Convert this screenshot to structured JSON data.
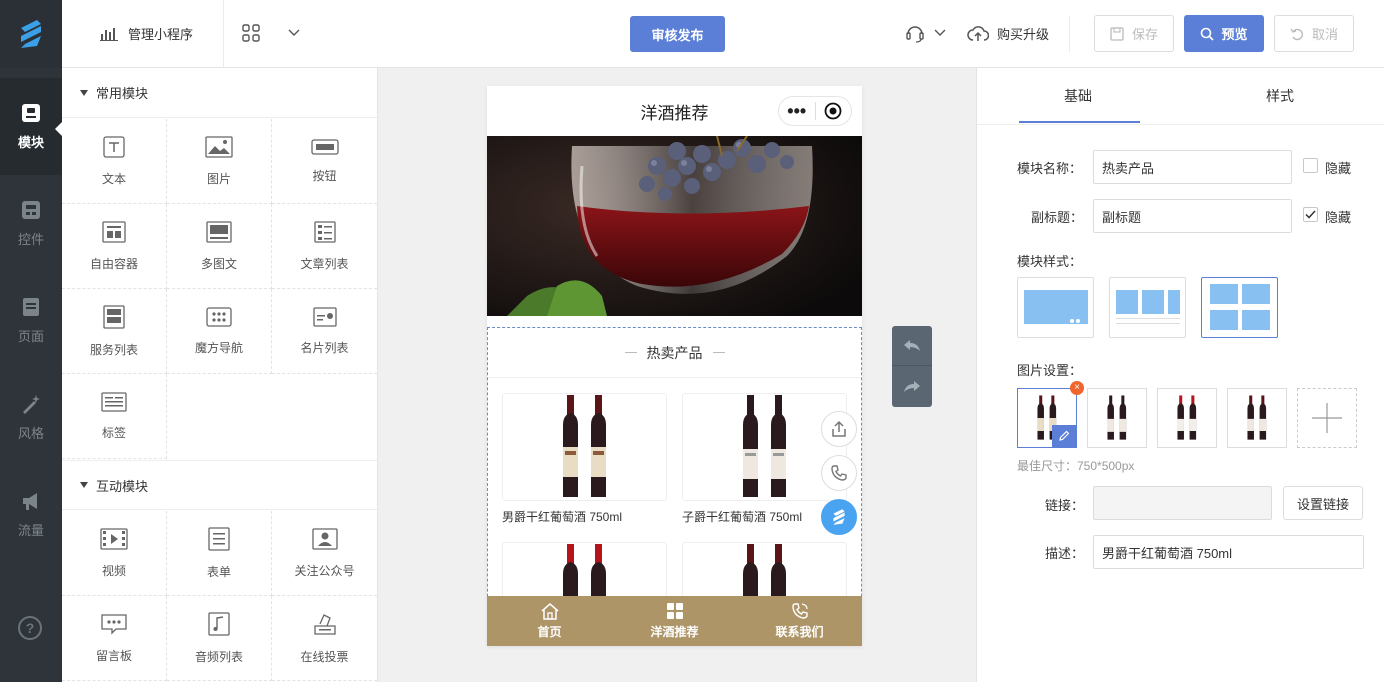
{
  "topbar": {
    "manage_label": "管理小程序",
    "publish_label": "审核发布",
    "upgrade_label": "购买升级",
    "save_label": "保存",
    "preview_label": "预览",
    "cancel_label": "取消"
  },
  "leftnav": {
    "items": [
      {
        "label": "模块",
        "icon": "module-icon"
      },
      {
        "label": "控件",
        "icon": "widget-icon"
      },
      {
        "label": "页面",
        "icon": "page-icon"
      },
      {
        "label": "风格",
        "icon": "style-wand-icon"
      },
      {
        "label": "流量",
        "icon": "megaphone-icon"
      }
    ],
    "help_icon": "help-icon"
  },
  "modules": {
    "common_title": "常用模块",
    "common_items": [
      {
        "label": "文本",
        "icon": "text-icon"
      },
      {
        "label": "图片",
        "icon": "image-icon"
      },
      {
        "label": "按钮",
        "icon": "button-icon"
      },
      {
        "label": "自由容器",
        "icon": "container-icon"
      },
      {
        "label": "多图文",
        "icon": "multi-article-icon"
      },
      {
        "label": "文章列表",
        "icon": "article-list-icon"
      },
      {
        "label": "服务列表",
        "icon": "service-list-icon"
      },
      {
        "label": "魔方导航",
        "icon": "cube-nav-icon"
      },
      {
        "label": "名片列表",
        "icon": "card-list-icon"
      },
      {
        "label": "标签",
        "icon": "tag-icon"
      }
    ],
    "interactive_title": "互动模块",
    "interactive_items": [
      {
        "label": "视频",
        "icon": "video-icon"
      },
      {
        "label": "表单",
        "icon": "form-icon"
      },
      {
        "label": "关注公众号",
        "icon": "follow-account-icon"
      },
      {
        "label": "留言板",
        "icon": "message-board-icon"
      },
      {
        "label": "音频列表",
        "icon": "audio-list-icon"
      },
      {
        "label": "在线投票",
        "icon": "vote-icon"
      }
    ]
  },
  "phone": {
    "title": "洋酒推荐",
    "section_title": "热卖产品",
    "products": [
      {
        "name": "男爵干红葡萄酒 750ml"
      },
      {
        "name": "子爵干红葡萄酒 750ml"
      },
      {
        "name": ""
      },
      {
        "name": ""
      }
    ],
    "tabs": [
      {
        "label": "首页",
        "icon": "home-icon"
      },
      {
        "label": "洋酒推荐",
        "icon": "grid-icon"
      },
      {
        "label": "联系我们",
        "icon": "phone-icon"
      }
    ]
  },
  "rightpanel": {
    "tab_basic": "基础",
    "tab_style": "样式",
    "name_label": "模块名称：",
    "name_value": "热卖产品",
    "hide_label": "隐藏",
    "subtitle_label": "副标题：",
    "subtitle_value": "副标题",
    "hide_label2": "隐藏",
    "style_label": "模块样式：",
    "image_label": "图片设置：",
    "size_hint": "最佳尺寸：750*500px",
    "link_label": "链接：",
    "link_value": "",
    "link_button": "设置链接",
    "desc_label": "描述：",
    "desc_value": "男爵干红葡萄酒 750ml"
  },
  "colors": {
    "accent": "#5b7fd6",
    "sidebar": "#2e3439",
    "tabbar": "#ad9568"
  }
}
